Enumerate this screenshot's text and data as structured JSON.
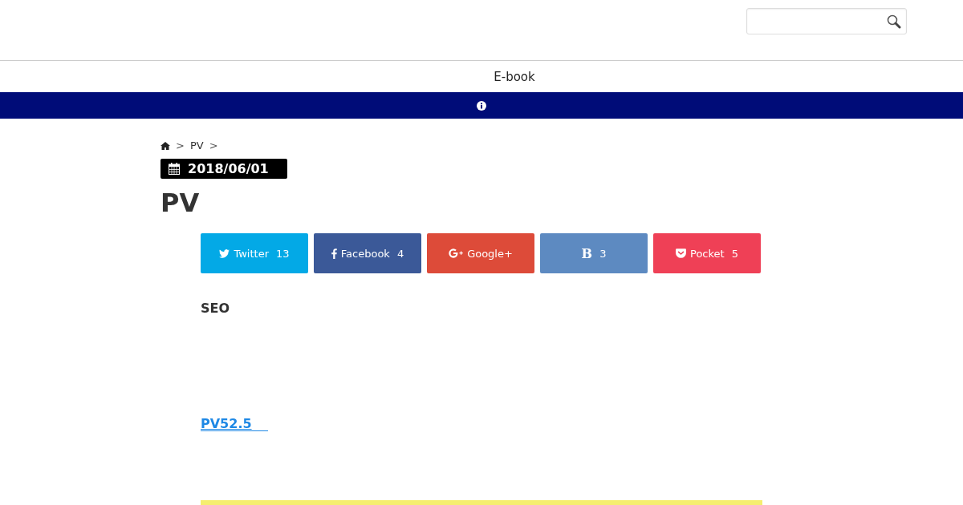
{
  "nav": {
    "items": [
      "E-book"
    ]
  },
  "breadcrumb": {
    "items": [
      {
        "kind": "separator",
        "text": ">"
      },
      {
        "kind": "link",
        "text": "PV"
      },
      {
        "kind": "separator",
        "text": ">"
      }
    ]
  },
  "post": {
    "date": "2018/06/01",
    "title": "PV"
  },
  "share_buttons": [
    {
      "kind": "twitter",
      "label": "Twitter",
      "count": "13"
    },
    {
      "kind": "facebook",
      "label": "Facebook",
      "count": "4"
    },
    {
      "kind": "googleplus",
      "label": "Google+"
    },
    {
      "kind": "hatena",
      "label": "B",
      "count": "3"
    },
    {
      "kind": "pocket",
      "label": "Pocket",
      "count": "5"
    }
  ],
  "body": {
    "heading": "SEO",
    "link": "PV52.5"
  }
}
